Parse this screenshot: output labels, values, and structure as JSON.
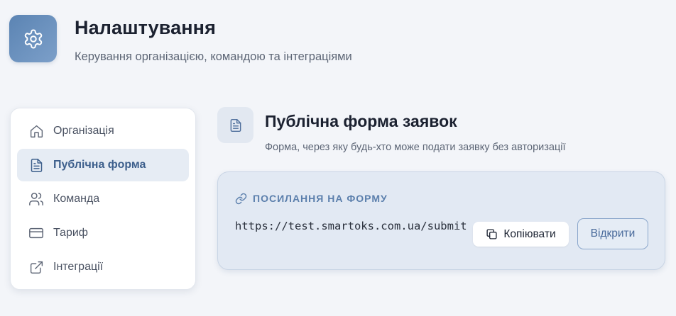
{
  "header": {
    "icon": "gear-icon",
    "title": "Налаштування",
    "subtitle": "Керування організацією, командою та інтеграціями"
  },
  "sidebar": {
    "items": [
      {
        "label": "Організація",
        "icon": "home-icon",
        "active": false
      },
      {
        "label": "Публічна форма",
        "icon": "document-icon",
        "active": true
      },
      {
        "label": "Команда",
        "icon": "users-icon",
        "active": false
      },
      {
        "label": "Тариф",
        "icon": "credit-card-icon",
        "active": false
      },
      {
        "label": "Інтеграції",
        "icon": "external-link-icon",
        "active": false
      }
    ]
  },
  "section": {
    "icon": "document-icon",
    "title": "Публічна форма заявок",
    "subtitle": "Форма, через яку будь-хто може подати заявку без авторизації"
  },
  "link_card": {
    "label": "ПОСИЛАННЯ НА ФОРМУ",
    "label_icon": "link-icon",
    "url": "https://test.smartoks.com.ua/submit",
    "copy_label": "Копіювати",
    "copy_icon": "copy-icon",
    "open_label": "Відкрити"
  },
  "colors": {
    "accent": "#5b7fac",
    "active_bg": "#e6ecf4",
    "card_bg": "#e2e9f3",
    "page_bg": "#f3f5f9"
  }
}
